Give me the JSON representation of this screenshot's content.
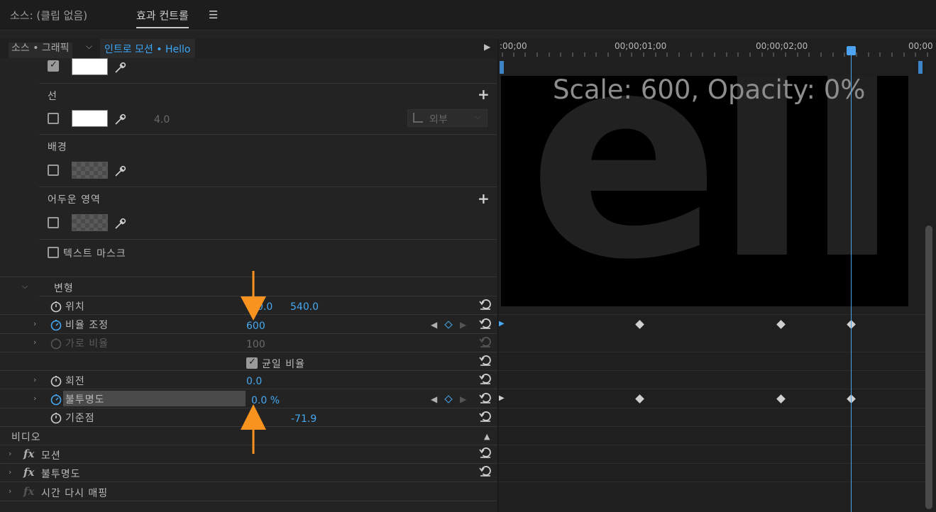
{
  "tabs": {
    "source": "소스: (클립 없음)",
    "effects": "효과 컨트롤",
    "menu_icon": "☰"
  },
  "clip_header": {
    "source_label": "소스 • 그래픽",
    "clip_label": "인트로 모션 • Hello"
  },
  "properties": {
    "stroke_label": "선",
    "stroke_width": "4.0",
    "stroke_position": "외부",
    "background_label": "배경",
    "shadow_label": "어두운 영역",
    "text_mask_label": "텍스트 마스크",
    "transform_label": "변형",
    "position_label": "위치",
    "position_x": "0.0",
    "position_y": "540.0",
    "scale_label": "비율 조정",
    "scale_value": "600",
    "scale_width_label": "가로 비율",
    "scale_width_value": "100",
    "uniform_scale_label": "균일 비율",
    "rotation_label": "회전",
    "rotation_value": "0.0",
    "opacity_label": "불투명도",
    "opacity_value": "0.0 %",
    "anchor_label": "기준점",
    "anchor_y": "-71.9"
  },
  "video_section": {
    "label": "비디오",
    "effects": [
      "모션",
      "불투명도",
      "시간 다시 매핑"
    ]
  },
  "timeline": {
    "timecodes": [
      ":00;00",
      "00;00;01;00",
      "00;00;02;00",
      "00;00"
    ],
    "overlay_text": "Scale: 600, Opacity: 0%",
    "preview_text": "ell"
  },
  "colors": {
    "accent_blue": "#46a8f0",
    "arrow_orange": "#f7931e"
  }
}
